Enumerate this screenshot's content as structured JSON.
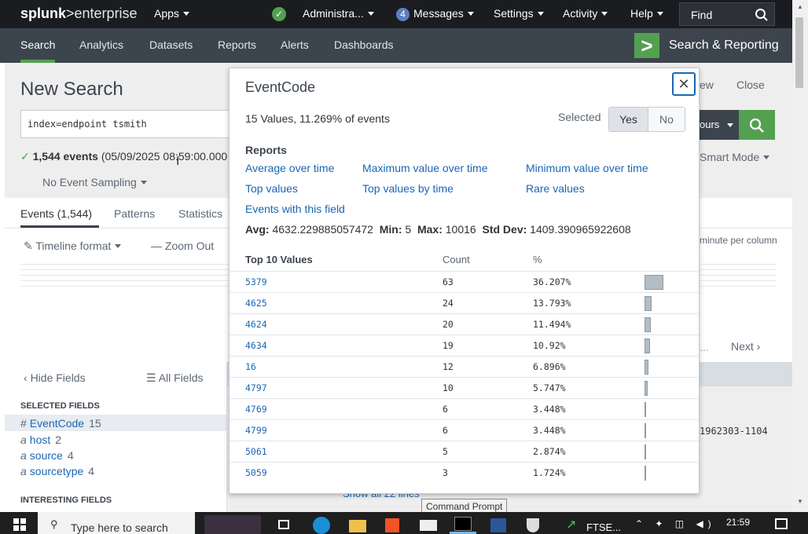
{
  "topbar": {
    "logo_splunk": "splunk",
    "logo_enterprise": ">enterprise",
    "apps": "Apps",
    "admin": "Administra...",
    "messages_count": "4",
    "messages": "Messages",
    "settings": "Settings",
    "activity": "Activity",
    "help": "Help",
    "find": "Find"
  },
  "appbar": {
    "tabs": [
      "Search",
      "Analytics",
      "Datasets",
      "Reports",
      "Alerts",
      "Dashboards"
    ],
    "app_title": "Search & Reporting"
  },
  "page": {
    "title": "New Search",
    "search_query": "index=endpoint tsmith",
    "events_count": "1,544 events",
    "events_range": "(05/09/2025 08:59:00.000",
    "sampling": "No Event Sampling",
    "view_fragment": "ew",
    "close": "Close",
    "time_fragment": "ours",
    "smart_mode": "Smart Mode",
    "tabs": [
      "Events (1,544)",
      "Patterns",
      "Statistics"
    ],
    "timeline_format": "Timeline format",
    "zoom_out": "Zoom Out",
    "minute_per_column": "minute per column",
    "ellipsis": "...",
    "next": "Next",
    "hide_fields": "Hide Fields",
    "all_fields": "All Fields",
    "selected_fields_heading": "SELECTED FIELDS",
    "selected_fields": [
      {
        "type": "#",
        "name": "EventCode",
        "count": "15"
      },
      {
        "type": "a",
        "name": "host",
        "count": "2"
      },
      {
        "type": "a",
        "name": "source",
        "count": "4"
      },
      {
        "type": "a",
        "name": "sourcetype",
        "count": "4"
      }
    ],
    "interesting_fields_heading": "INTERESTING FIELDS",
    "sid_fragment": "1962303-1104",
    "show_all_lines": "Show all 22 lines",
    "tooltip": "Command Prompt"
  },
  "popup": {
    "title": "EventCode",
    "close_icon": "close-icon",
    "summary": "15 Values, 11.269% of events",
    "selected_label": "Selected",
    "yes": "Yes",
    "no": "No",
    "reports_heading": "Reports",
    "reports": [
      "Average over time",
      "Maximum value over time",
      "Minimum value over time",
      "Top values",
      "Top values by time",
      "Rare values"
    ],
    "events_with_field": "Events with this field",
    "stats": {
      "avg_label": "Avg:",
      "avg": "4632.229885057472",
      "min_label": "Min:",
      "min": "5",
      "max_label": "Max:",
      "max": "10016",
      "std_label": "Std Dev:",
      "std": "1409.390965922608"
    },
    "table_headers": [
      "Top 10 Values",
      "Count",
      "%"
    ],
    "top_values": [
      {
        "value": "5379",
        "count": "63",
        "pct": "36.207%",
        "frac": 0.36207
      },
      {
        "value": "4625",
        "count": "24",
        "pct": "13.793%",
        "frac": 0.13793
      },
      {
        "value": "4624",
        "count": "20",
        "pct": "11.494%",
        "frac": 0.11494
      },
      {
        "value": "4634",
        "count": "19",
        "pct": "10.92%",
        "frac": 0.1092
      },
      {
        "value": "16",
        "count": "12",
        "pct": "6.896%",
        "frac": 0.06896
      },
      {
        "value": "4797",
        "count": "10",
        "pct": "5.747%",
        "frac": 0.05747
      },
      {
        "value": "4769",
        "count": "6",
        "pct": "3.448%",
        "frac": 0.03448
      },
      {
        "value": "4799",
        "count": "6",
        "pct": "3.448%",
        "frac": 0.03448
      },
      {
        "value": "5061",
        "count": "5",
        "pct": "2.874%",
        "frac": 0.02874
      },
      {
        "value": "5059",
        "count": "3",
        "pct": "1.724%",
        "frac": 0.01724
      }
    ]
  },
  "taskbar": {
    "search_placeholder": "Type here to search",
    "ftse": "FTSE...",
    "time": "21:59"
  },
  "colors": {
    "topbar": "#1a1c20",
    "appbar": "#3c444d",
    "accent_green": "#53a051",
    "link_blue": "#1a66b5",
    "taskbar": "#1f1f1f"
  }
}
